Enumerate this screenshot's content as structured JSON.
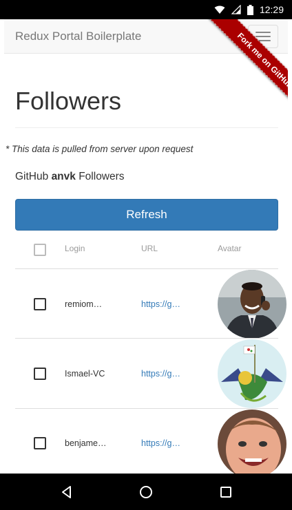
{
  "status_bar": {
    "time": "12:29"
  },
  "navbar": {
    "brand": "Redux Portal Boilerplate",
    "ribbon_text": "Fork me on GitHub"
  },
  "page": {
    "title": "Followers",
    "note": "* This data is pulled from server upon request",
    "subtitle_prefix": "GitHub ",
    "subtitle_user": "anvk",
    "subtitle_suffix": " Followers",
    "refresh_label": "Refresh"
  },
  "table": {
    "headers": {
      "login": "Login",
      "url": "URL",
      "avatar": "Avatar"
    },
    "rows": [
      {
        "login": "remiom…",
        "url": "https://g…"
      },
      {
        "login": "Ismael-VC",
        "url": "https://g…"
      },
      {
        "login": "benjame…",
        "url": "https://g…"
      }
    ]
  },
  "colors": {
    "primary": "#337ab7",
    "ribbon": "#aa0000",
    "link": "#337ab7"
  },
  "icons": [
    "wifi-icon",
    "signal-icon",
    "battery-icon",
    "back-icon",
    "home-icon",
    "recents-icon"
  ]
}
